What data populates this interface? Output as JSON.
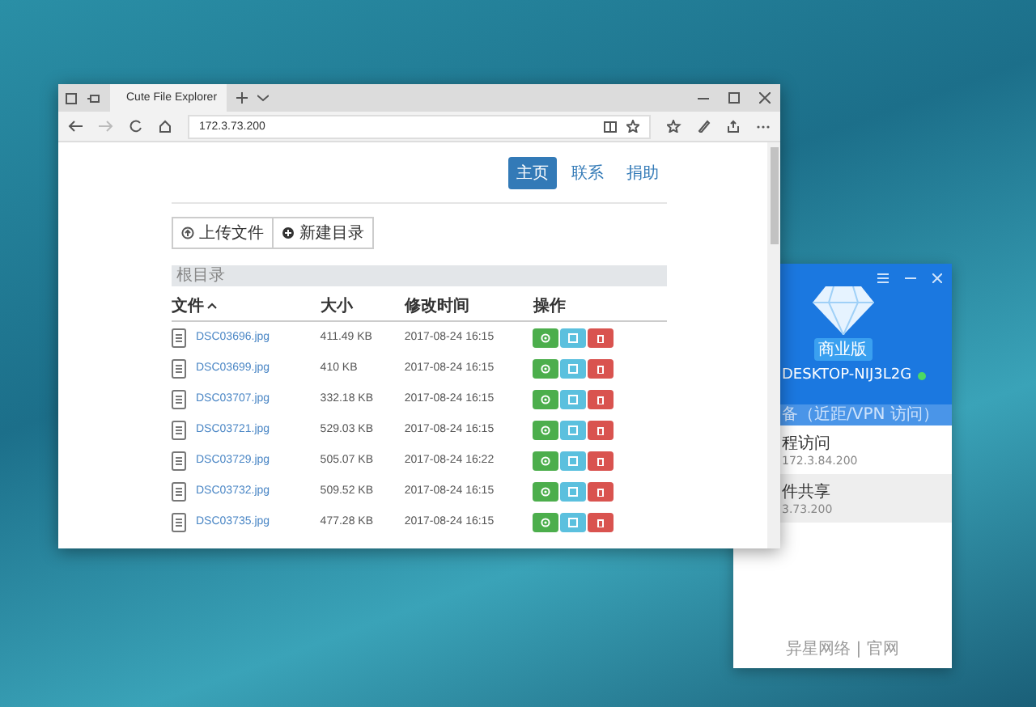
{
  "browser": {
    "tab_title": "Cute File Explorer",
    "address": "172.3.73.200",
    "nav": [
      {
        "label": "主页",
        "selected": true
      },
      {
        "label": "联系",
        "selected": false
      },
      {
        "label": "捐助",
        "selected": false
      }
    ],
    "actions": [
      "上传文件",
      "新建目录"
    ],
    "breadcrumb": "根目录",
    "table": {
      "columns": [
        "文件",
        "大小",
        "修改时间",
        "操作"
      ],
      "rows": [
        {
          "name": "DSC03696.jpg",
          "size": "411.49 KB",
          "modified": "2017-08-24 16:15"
        },
        {
          "name": "DSC03699.jpg",
          "size": "410 KB",
          "modified": "2017-08-24 16:15"
        },
        {
          "name": "DSC03707.jpg",
          "size": "332.18 KB",
          "modified": "2017-08-24 16:15"
        },
        {
          "name": "DSC03721.jpg",
          "size": "529.03 KB",
          "modified": "2017-08-24 16:15"
        },
        {
          "name": "DSC03729.jpg",
          "size": "505.07 KB",
          "modified": "2017-08-24 16:22"
        },
        {
          "name": "DSC03732.jpg",
          "size": "509.52 KB",
          "modified": "2017-08-24 16:15"
        },
        {
          "name": "DSC03735.jpg",
          "size": "477.28 KB",
          "modified": "2017-08-24 16:15"
        }
      ]
    }
  },
  "side_app": {
    "badge": "商业版",
    "device": "DESKTOP-NIJ3L2G",
    "online": true,
    "section": "备（近距/VPN 访问）",
    "items": [
      {
        "title": "程访问",
        "detail": "172.3.84.200",
        "selected": false
      },
      {
        "title": "件共享",
        "detail": "3.73.200",
        "selected": true
      }
    ],
    "footer": "异星网络 | 官网"
  }
}
